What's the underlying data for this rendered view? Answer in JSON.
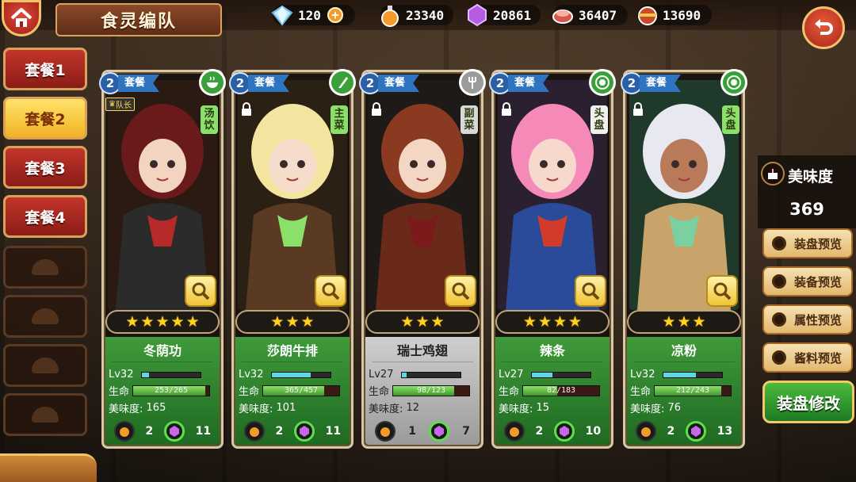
{
  "header": {
    "title": "食灵编队",
    "resources": [
      {
        "icon": "diamond-icon",
        "value": "120",
        "has_plus": true
      },
      {
        "icon": "potion-icon",
        "value": "23340"
      },
      {
        "icon": "crystal-icon",
        "value": "20861"
      },
      {
        "icon": "meat-icon",
        "value": "36407"
      },
      {
        "icon": "drumstick-icon",
        "value": "13690"
      }
    ],
    "plus_label": "+"
  },
  "tabs": [
    {
      "label": "套餐1",
      "active": false
    },
    {
      "label": "套餐2",
      "active": true
    },
    {
      "label": "套餐3",
      "active": false
    },
    {
      "label": "套餐4",
      "active": false
    }
  ],
  "cards": [
    {
      "badge_num": "2",
      "badge_label": "套餐",
      "type_tag": "汤饮",
      "type_icon": "bowl-icon",
      "captain_label": "队长",
      "is_captain": true,
      "stars": 5,
      "name": "冬荫功",
      "level": "Lv32",
      "level_pct": 0.12,
      "hp_label": "生命",
      "hp_text": "253/265",
      "hp_pct": 0.95,
      "taste_label": "美味度:",
      "taste": "165",
      "potion_count": "2",
      "crystal_count": "11",
      "theme": "green",
      "tag_color": "#8be06a"
    },
    {
      "badge_num": "2",
      "badge_label": "套餐",
      "type_tag": "主菜",
      "type_icon": "knife-icon",
      "is_captain": false,
      "stars": 3,
      "name": "莎朗牛排",
      "level": "Lv32",
      "level_pct": 0.65,
      "hp_label": "生命",
      "hp_text": "365/457",
      "hp_pct": 0.8,
      "taste_label": "美味度:",
      "taste": "101",
      "potion_count": "2",
      "crystal_count": "11",
      "theme": "green",
      "tag_color": "#8be06a"
    },
    {
      "badge_num": "2",
      "badge_label": "套餐",
      "type_tag": "副菜",
      "type_icon": "fork-icon",
      "is_captain": false,
      "stars": 3,
      "name": "瑞士鸡翅",
      "level": "Lv27",
      "level_pct": 0.08,
      "hp_label": "生命",
      "hp_text": "98/123",
      "hp_pct": 0.8,
      "taste_label": "美味度:",
      "taste": "12",
      "potion_count": "1",
      "crystal_count": "7",
      "theme": "gray",
      "tag_color": "#d8d8d8"
    },
    {
      "badge_num": "2",
      "badge_label": "套餐",
      "type_tag": "头盘",
      "type_icon": "plate-icon",
      "is_captain": false,
      "stars": 4,
      "name": "辣条",
      "level": "Lv27",
      "level_pct": 0.35,
      "hp_label": "生命",
      "hp_text": "82/183",
      "hp_pct": 0.45,
      "taste_label": "美味度:",
      "taste": "15",
      "potion_count": "2",
      "crystal_count": "10",
      "theme": "green",
      "tag_color": "#f0f0f0"
    },
    {
      "badge_num": "2",
      "badge_label": "套餐",
      "type_tag": "头盘",
      "type_icon": "plate-icon",
      "is_captain": false,
      "stars": 3,
      "name": "凉粉",
      "level": "Lv32",
      "level_pct": 0.55,
      "hp_label": "生命",
      "hp_text": "212/243",
      "hp_pct": 0.87,
      "taste_label": "美味度:",
      "taste": "76",
      "potion_count": "2",
      "crystal_count": "13",
      "theme": "green",
      "tag_color": "#8be06a"
    }
  ],
  "right_panel": {
    "taste_title": "美味度",
    "taste_value": "369",
    "options": [
      "装盘预览",
      "装备预览",
      "属性预览",
      "酱料预览"
    ],
    "edit_button": "装盘修改"
  }
}
